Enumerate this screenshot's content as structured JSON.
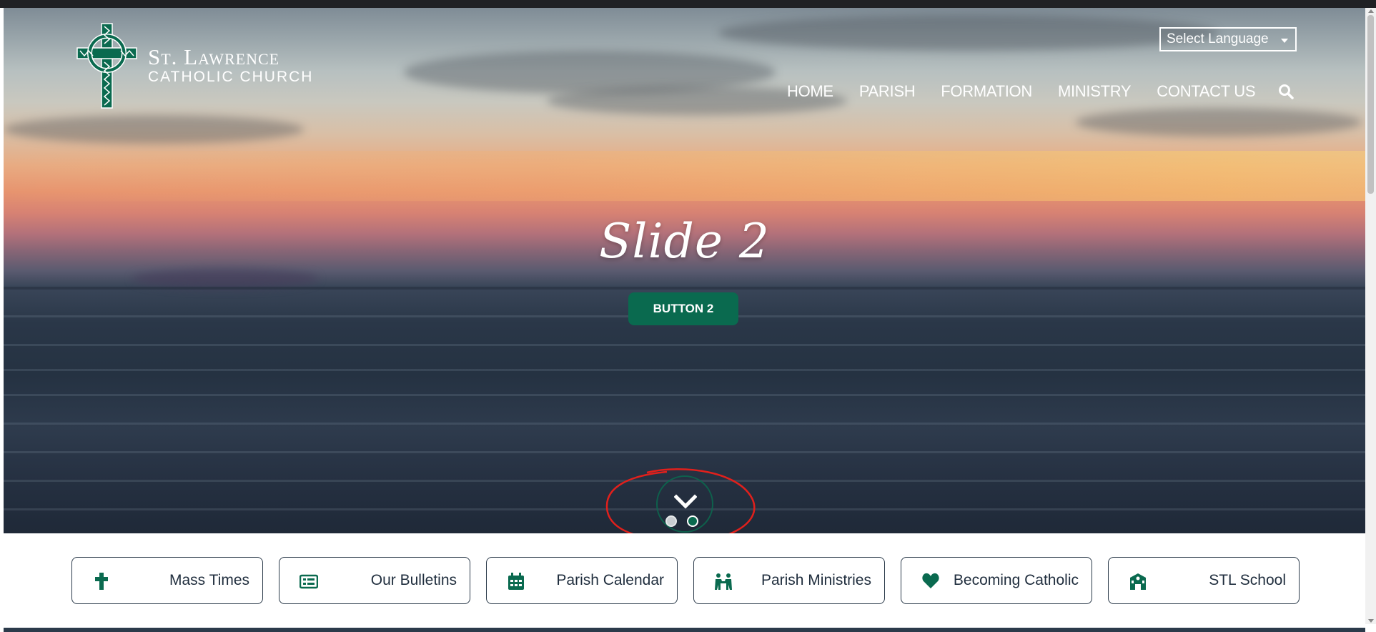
{
  "header": {
    "church_name_line1": "St. Lawrence",
    "church_name_line2": "CATHOLIC CHURCH",
    "language_select": "Select Language",
    "nav": [
      "HOME",
      "PARISH",
      "FORMATION",
      "MINISTRY",
      "CONTACT US"
    ]
  },
  "hero": {
    "title": "Slide 2",
    "button": "BUTTON 2",
    "slide_count": 2,
    "active_slide": 2
  },
  "quicklinks": [
    {
      "label": "Mass Times",
      "icon": "cross-icon"
    },
    {
      "label": "Our Bulletins",
      "icon": "newspaper-icon"
    },
    {
      "label": "Parish Calendar",
      "icon": "calendar-icon"
    },
    {
      "label": "Parish Ministries",
      "icon": "people-icon"
    },
    {
      "label": "Becoming Catholic",
      "icon": "heart-icon"
    },
    {
      "label": "STL School",
      "icon": "school-icon"
    }
  ],
  "colors": {
    "brand_green": "#0a6a4f",
    "text_dark": "#1f2d3d",
    "annotation_red": "#e0201c"
  }
}
